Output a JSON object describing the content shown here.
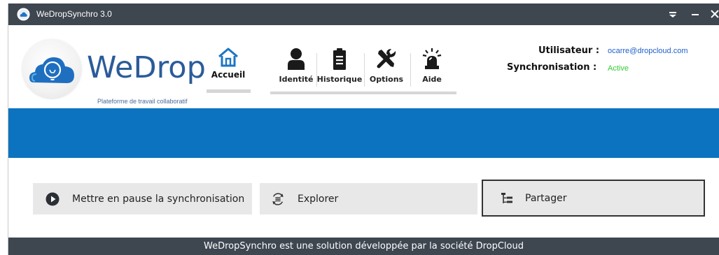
{
  "window": {
    "title": "WeDropSynchro 3.0"
  },
  "brand": {
    "name": "WeDrop",
    "tagline": "Plateforme de travail collaboratif",
    "colors": {
      "brand_blue": "#2b5b9a",
      "band_blue": "#0b73bf",
      "titlebar": "#3e4650"
    }
  },
  "nav": {
    "items": [
      {
        "label": "Accueil",
        "icon": "home-icon",
        "active": true
      },
      {
        "label": "Identité",
        "icon": "user-icon"
      },
      {
        "label": "Historique",
        "icon": "clipboard-icon"
      },
      {
        "label": "Options",
        "icon": "tools-icon"
      },
      {
        "label": "Aide",
        "icon": "alarm-light-icon"
      }
    ]
  },
  "info": {
    "user_label": "Utilisateur :",
    "user_value": "ocarre@dropcloud.com",
    "sync_label": "Synchronisation :",
    "sync_value": "Active",
    "sync_color": "#33cc33"
  },
  "actions": [
    {
      "label": "Mettre en pause la synchronisation",
      "icon": "play-circle-icon"
    },
    {
      "label": "Explorer",
      "icon": "list-circle-icon"
    },
    {
      "label": "Partager",
      "icon": "tree-icon",
      "focused": true
    }
  ],
  "footer": {
    "text": "WeDropSynchro est une solution développée par la société DropCloud"
  }
}
